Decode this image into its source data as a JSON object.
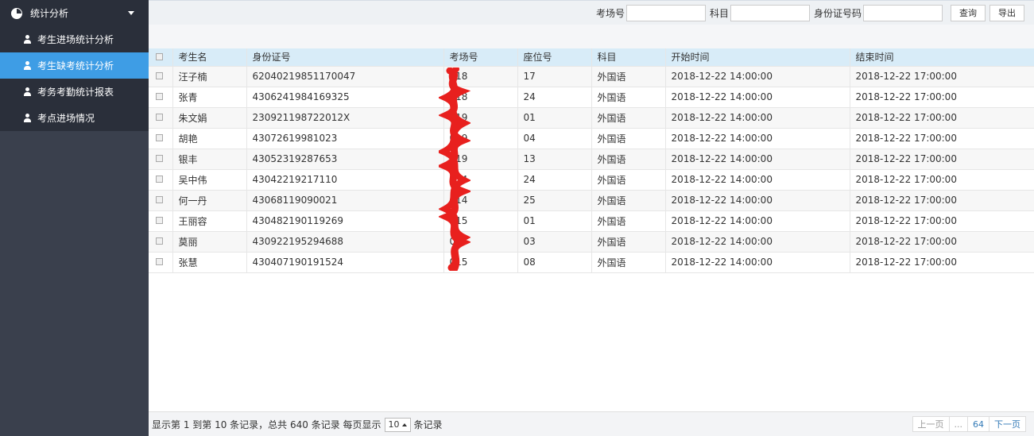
{
  "sidebar": {
    "header": "统计分析",
    "items": [
      {
        "label": "考生进场统计分析"
      },
      {
        "label": "考生缺考统计分析"
      },
      {
        "label": "考务考勤统计报表"
      },
      {
        "label": "考点进场情况"
      }
    ]
  },
  "toolbar": {
    "exam_room_label": "考场号",
    "subject_label": "科目",
    "id_label": "身份证号码",
    "exam_room_value": "",
    "subject_value": "",
    "id_value": "",
    "query_button": "查询",
    "export_button": "导出"
  },
  "table": {
    "headers": [
      "考生名",
      "身份证号",
      "考场号",
      "座位号",
      "科目",
      "开始时间",
      "结束时间"
    ],
    "rows": [
      [
        "汪子楠",
        "62040219851170047",
        "018",
        "17",
        "外国语",
        "2018-12-22 14:00:00",
        "2018-12-22 17:00:00"
      ],
      [
        "张青",
        "4306241984169325",
        "018",
        "24",
        "外国语",
        "2018-12-22 14:00:00",
        "2018-12-22 17:00:00"
      ],
      [
        "朱文娟",
        "230921198722012X",
        "019",
        "01",
        "外国语",
        "2018-12-22 14:00:00",
        "2018-12-22 17:00:00"
      ],
      [
        "胡艳",
        "43072619981023",
        "019",
        "04",
        "外国语",
        "2018-12-22 14:00:00",
        "2018-12-22 17:00:00"
      ],
      [
        "银丰",
        "43052319287653",
        "019",
        "13",
        "外国语",
        "2018-12-22 14:00:00",
        "2018-12-22 17:00:00"
      ],
      [
        "吴中伟",
        "43042219217110",
        "014",
        "24",
        "外国语",
        "2018-12-22 14:00:00",
        "2018-12-22 17:00:00"
      ],
      [
        "何一丹",
        "43068119090021",
        "014",
        "25",
        "外国语",
        "2018-12-22 14:00:00",
        "2018-12-22 17:00:00"
      ],
      [
        "王丽容",
        "430482190119269",
        "015",
        "01",
        "外国语",
        "2018-12-22 14:00:00",
        "2018-12-22 17:00:00"
      ],
      [
        "莫丽",
        "430922195294688",
        "015",
        "03",
        "外国语",
        "2018-12-22 14:00:00",
        "2018-12-22 17:00:00"
      ],
      [
        "张慧",
        "430407190191524",
        "015",
        "08",
        "外国语",
        "2018-12-22 14:00:00",
        "2018-12-22 17:00:00"
      ]
    ]
  },
  "footer": {
    "info_prefix": "显示第 1 到第 10 条记录，总共 640 条记录 每页显示",
    "page_size": "10",
    "info_suffix": "条记录",
    "prev": "上一页",
    "ellipsis": "...",
    "last_page": "64",
    "next": "下一页"
  },
  "colors": {
    "sidebar_bg": "#353b48",
    "active_item": "#3e9de5",
    "header_row": "#d8ecf8",
    "redaction": "#e8201e"
  }
}
